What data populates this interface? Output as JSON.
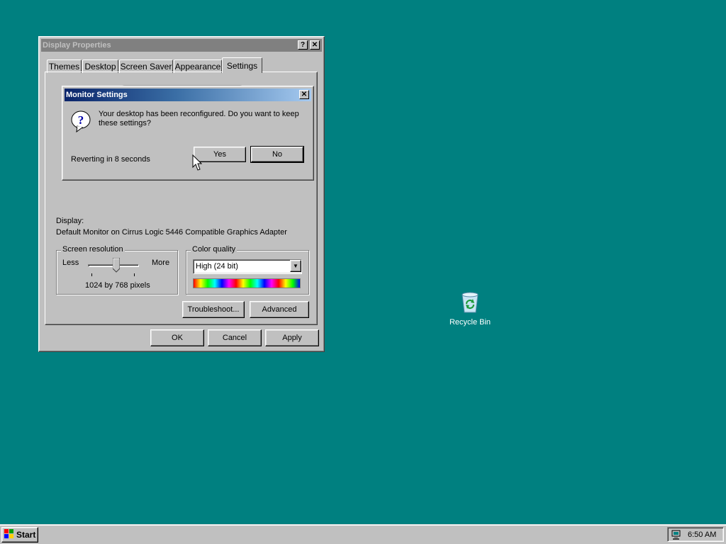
{
  "display_properties": {
    "title": "Display Properties",
    "help_button": "?",
    "close_button": "✕",
    "tabs": [
      "Themes",
      "Desktop",
      "Screen Saver",
      "Appearance",
      "Settings"
    ],
    "display_label": "Display:",
    "display_value": "Default Monitor on Cirrus Logic 5446 Compatible Graphics Adapter",
    "screen_resolution": {
      "legend": "Screen resolution",
      "less": "Less",
      "more": "More",
      "value_text": "1024 by 768 pixels",
      "slider_fraction": 0.5
    },
    "color_quality": {
      "legend": "Color quality",
      "selected": "High (24 bit)"
    },
    "troubleshoot_button": "Troubleshoot...",
    "advanced_button": "Advanced",
    "ok_button": "OK",
    "cancel_button": "Cancel",
    "apply_button": "Apply"
  },
  "monitor_settings": {
    "title": "Monitor Settings",
    "close_button": "✕",
    "message": "Your desktop has been reconfigured.  Do you want to keep these settings?",
    "countdown": "Reverting in 8 seconds",
    "yes_button": "Yes",
    "no_button": "No"
  },
  "desktop": {
    "recycle_bin_label": "Recycle Bin"
  },
  "taskbar": {
    "start_label": "Start",
    "clock": "6:50 AM"
  },
  "colors": {
    "desktop_bg": "#008080",
    "face": "#c0c0c0",
    "active_title": "#0a246a",
    "inactive_title": "#808080"
  }
}
